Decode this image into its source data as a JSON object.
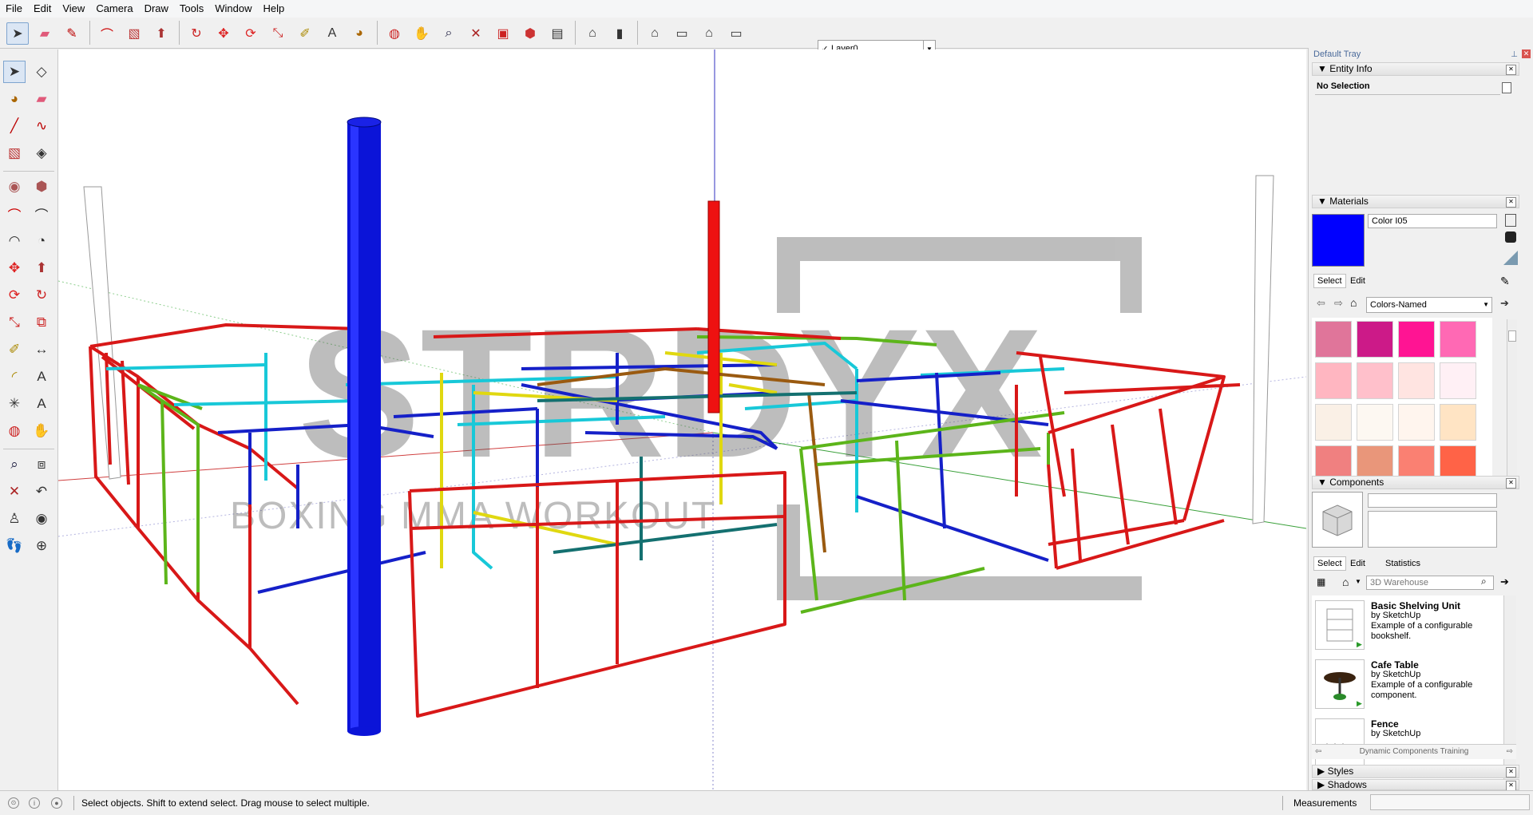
{
  "menu": [
    "File",
    "Edit",
    "View",
    "Camera",
    "Draw",
    "Tools",
    "Window",
    "Help"
  ],
  "toolbar": {
    "icons": [
      "select-icon",
      "eraser-icon",
      "pencil-icon",
      "arc-icon",
      "rectangle-icon",
      "push-pull-icon",
      "follow-me-icon",
      "move-icon",
      "rotate-icon",
      "scale-icon",
      "tape-measure-icon",
      "text-icon",
      "paint-bucket-icon",
      "orbit-icon",
      "pan-icon",
      "zoom-icon",
      "zoom-extents-icon",
      "get-models-icon",
      "share-model-icon",
      "extension-warehouse-icon",
      "iso-view-icon",
      "top-view-icon",
      "front-view-icon",
      "right-view-icon",
      "back-view-icon",
      "left-view-icon"
    ],
    "layer": "Layer0"
  },
  "left_tools": [
    "select-icon",
    "make-component-icon",
    "paint-bucket-icon",
    "eraser-icon",
    "line-icon",
    "freehand-icon",
    "rectangle-icon",
    "rotated-rectangle-icon",
    "circle-icon",
    "polygon-icon",
    "arc-icon",
    "two-point-arc-icon",
    "three-point-arc-icon",
    "pie-icon",
    "move-icon",
    "push-pull-icon",
    "rotate-icon",
    "follow-me-icon",
    "scale-icon",
    "offset-icon",
    "tape-measure-icon",
    "dimension-icon",
    "protractor-icon",
    "text-icon",
    "axes-icon",
    "3d-text-icon",
    "orbit-icon",
    "pan-icon",
    "zoom-icon",
    "zoom-window-icon",
    "zoom-extents-icon",
    "previous-view-icon",
    "position-camera-icon",
    "look-around-icon",
    "walk-icon",
    "section-plane-icon"
  ],
  "viewport": {
    "watermark_main": "STRDYX",
    "watermark_sub": "BOXING MMA WORKOUT"
  },
  "tray": {
    "title": "Default Tray",
    "entity_info": {
      "header": "Entity Info",
      "value": "No Selection"
    },
    "materials": {
      "header": "Materials",
      "name": "Color I05",
      "current_color": "#0000ff",
      "tabs": [
        "Select",
        "Edit"
      ],
      "library": "Colors-Named",
      "swatches": [
        "#e0759a",
        "#cc1a88",
        "#ff1493",
        "#ff69b4",
        "#ffb6c1",
        "#ffc0cb",
        "#ffe4e1",
        "#fff0f5",
        "#faf0e6",
        "#fdf8f2",
        "#fff5ee",
        "#ffe4c4",
        "#f08080",
        "#e9967a",
        "#fa8072",
        "#ff6347"
      ]
    },
    "components": {
      "header": "Components",
      "tabs": [
        "Select",
        "Edit",
        "Statistics"
      ],
      "search_placeholder": "3D Warehouse",
      "items": [
        {
          "title": "Basic Shelving Unit",
          "by": "by SketchUp",
          "desc": "Example of a configurable bookshelf."
        },
        {
          "title": "Cafe Table",
          "by": "by SketchUp",
          "desc": "Example of a configurable component."
        },
        {
          "title": "Fence",
          "by": "by SketchUp",
          "desc": ""
        }
      ],
      "collection": "Dynamic Components Training"
    },
    "styles": {
      "header": "Styles"
    },
    "shadows": {
      "header": "Shadows"
    }
  },
  "status": {
    "message": "Select objects. Shift to extend select. Drag mouse to select multiple.",
    "measurements_label": "Measurements",
    "measurements_value": ""
  }
}
